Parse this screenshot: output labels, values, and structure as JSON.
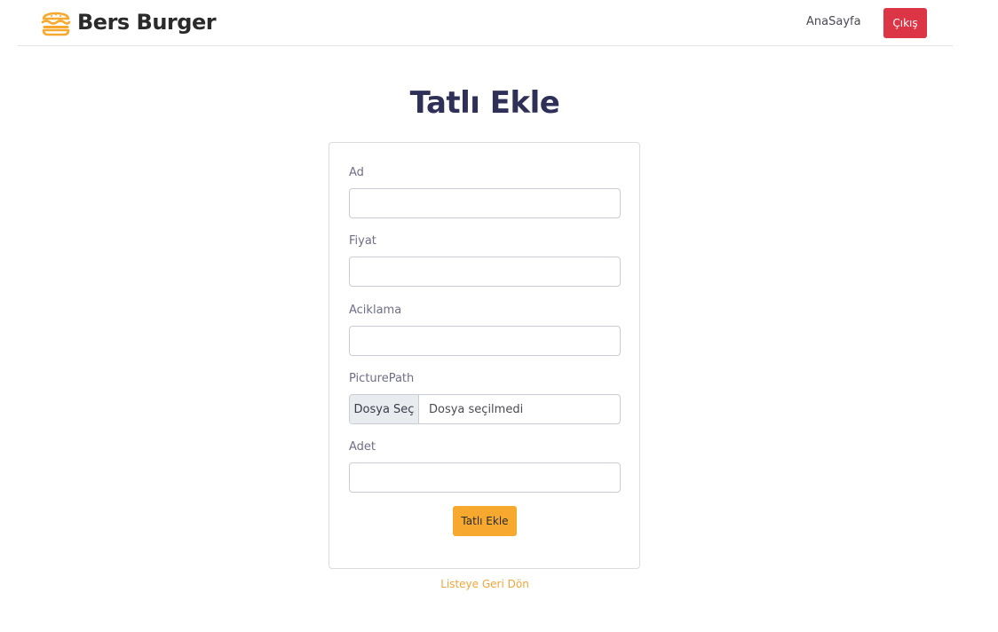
{
  "nav": {
    "brand": "Bers Burger",
    "home_label": "AnaSayfa",
    "logout_label": "Çıkış",
    "brand_color": "#f6a92e",
    "logout_color": "#dc3545"
  },
  "page": {
    "title": "Tatlı Ekle"
  },
  "form": {
    "fields": [
      {
        "label": "Ad",
        "value": ""
      },
      {
        "label": "Fiyat",
        "value": ""
      },
      {
        "label": "Aciklama",
        "value": ""
      },
      {
        "label": "PicturePath",
        "button": "Dosya Seç",
        "status": "Dosya seçilmedi"
      },
      {
        "label": "Adet",
        "value": ""
      }
    ],
    "submit_label": "Tatlı Ekle"
  },
  "back_link": "Listeye Geri Dön"
}
